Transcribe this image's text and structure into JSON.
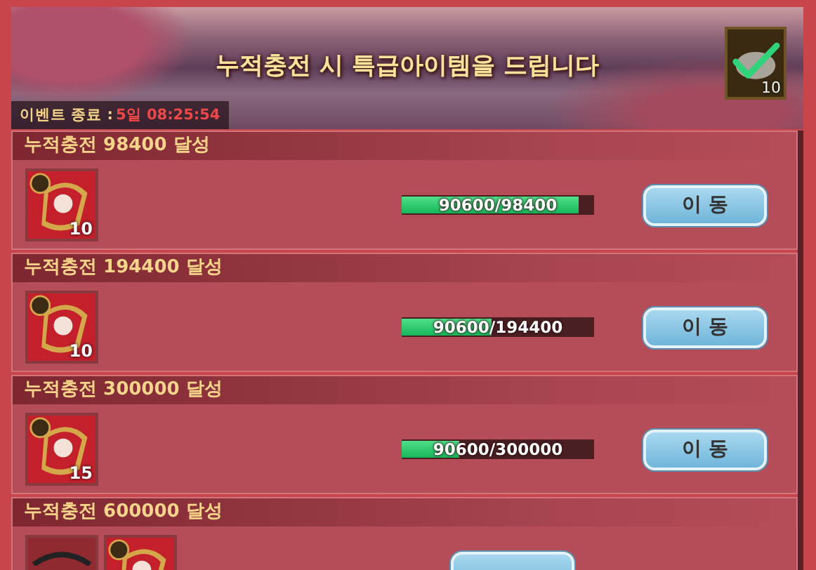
{
  "banner": {
    "title": "누적충전 시 특급아이템을 드립니다",
    "event_end_label": "이벤트 종료 :",
    "event_end_time": "5일 08:25:54",
    "reward": {
      "kind": "check",
      "count": "10"
    }
  },
  "rows": [
    {
      "title": "누적충전 98400 달성",
      "items": [
        {
          "kind": "crest",
          "count": "10"
        }
      ],
      "progress": {
        "level": 0.92,
        "reading": "90600/98400"
      },
      "button_label": "이 동"
    },
    {
      "title": "누적충전 194400 달성",
      "items": [
        {
          "kind": "crest",
          "count": "10"
        }
      ],
      "progress": {
        "level": 0.466,
        "reading": "90600/194400"
      },
      "button_label": "이 동"
    },
    {
      "title": "누적충전 300000 달성",
      "items": [
        {
          "kind": "crest",
          "count": "15"
        }
      ],
      "progress": {
        "level": 0.302,
        "reading": "90600/300000"
      },
      "button_label": "이 동"
    },
    {
      "title": "누적충전 600000 달성",
      "items": [
        {
          "kind": "rope"
        },
        {
          "kind": "crest"
        }
      ]
    }
  ]
}
